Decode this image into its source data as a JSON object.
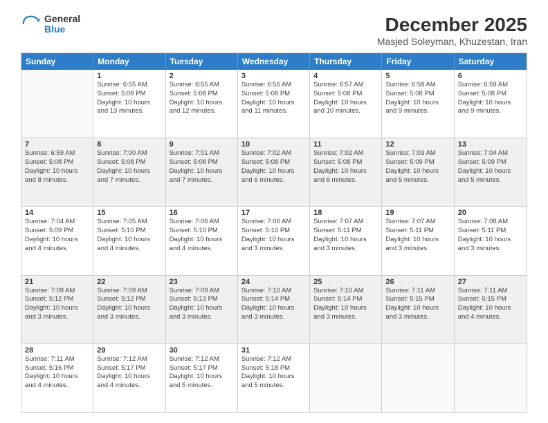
{
  "logo": {
    "general": "General",
    "blue": "Blue"
  },
  "title": "December 2025",
  "subtitle": "Masjed Soleyman, Khuzestan, Iran",
  "headers": [
    "Sunday",
    "Monday",
    "Tuesday",
    "Wednesday",
    "Thursday",
    "Friday",
    "Saturday"
  ],
  "rows": [
    [
      {
        "day": "",
        "empty": true
      },
      {
        "day": "1",
        "lines": [
          "Sunrise: 6:55 AM",
          "Sunset: 5:08 PM",
          "Daylight: 10 hours",
          "and 13 minutes."
        ]
      },
      {
        "day": "2",
        "lines": [
          "Sunrise: 6:55 AM",
          "Sunset: 5:08 PM",
          "Daylight: 10 hours",
          "and 12 minutes."
        ]
      },
      {
        "day": "3",
        "lines": [
          "Sunrise: 6:56 AM",
          "Sunset: 5:08 PM",
          "Daylight: 10 hours",
          "and 11 minutes."
        ]
      },
      {
        "day": "4",
        "lines": [
          "Sunrise: 6:57 AM",
          "Sunset: 5:08 PM",
          "Daylight: 10 hours",
          "and 10 minutes."
        ]
      },
      {
        "day": "5",
        "lines": [
          "Sunrise: 6:58 AM",
          "Sunset: 5:08 PM",
          "Daylight: 10 hours",
          "and 9 minutes."
        ]
      },
      {
        "day": "6",
        "lines": [
          "Sunrise: 6:59 AM",
          "Sunset: 5:08 PM",
          "Daylight: 10 hours",
          "and 9 minutes."
        ]
      }
    ],
    [
      {
        "day": "7",
        "lines": [
          "Sunrise: 6:59 AM",
          "Sunset: 5:08 PM",
          "Daylight: 10 hours",
          "and 8 minutes."
        ],
        "shaded": true
      },
      {
        "day": "8",
        "lines": [
          "Sunrise: 7:00 AM",
          "Sunset: 5:08 PM",
          "Daylight: 10 hours",
          "and 7 minutes."
        ],
        "shaded": true
      },
      {
        "day": "9",
        "lines": [
          "Sunrise: 7:01 AM",
          "Sunset: 5:08 PM",
          "Daylight: 10 hours",
          "and 7 minutes."
        ],
        "shaded": true
      },
      {
        "day": "10",
        "lines": [
          "Sunrise: 7:02 AM",
          "Sunset: 5:08 PM",
          "Daylight: 10 hours",
          "and 6 minutes."
        ],
        "shaded": true
      },
      {
        "day": "11",
        "lines": [
          "Sunrise: 7:02 AM",
          "Sunset: 5:08 PM",
          "Daylight: 10 hours",
          "and 6 minutes."
        ],
        "shaded": true
      },
      {
        "day": "12",
        "lines": [
          "Sunrise: 7:03 AM",
          "Sunset: 5:09 PM",
          "Daylight: 10 hours",
          "and 5 minutes."
        ],
        "shaded": true
      },
      {
        "day": "13",
        "lines": [
          "Sunrise: 7:04 AM",
          "Sunset: 5:09 PM",
          "Daylight: 10 hours",
          "and 5 minutes."
        ],
        "shaded": true
      }
    ],
    [
      {
        "day": "14",
        "lines": [
          "Sunrise: 7:04 AM",
          "Sunset: 5:09 PM",
          "Daylight: 10 hours",
          "and 4 minutes."
        ]
      },
      {
        "day": "15",
        "lines": [
          "Sunrise: 7:05 AM",
          "Sunset: 5:10 PM",
          "Daylight: 10 hours",
          "and 4 minutes."
        ]
      },
      {
        "day": "16",
        "lines": [
          "Sunrise: 7:06 AM",
          "Sunset: 5:10 PM",
          "Daylight: 10 hours",
          "and 4 minutes."
        ]
      },
      {
        "day": "17",
        "lines": [
          "Sunrise: 7:06 AM",
          "Sunset: 5:10 PM",
          "Daylight: 10 hours",
          "and 3 minutes."
        ]
      },
      {
        "day": "18",
        "lines": [
          "Sunrise: 7:07 AM",
          "Sunset: 5:11 PM",
          "Daylight: 10 hours",
          "and 3 minutes."
        ]
      },
      {
        "day": "19",
        "lines": [
          "Sunrise: 7:07 AM",
          "Sunset: 5:11 PM",
          "Daylight: 10 hours",
          "and 3 minutes."
        ]
      },
      {
        "day": "20",
        "lines": [
          "Sunrise: 7:08 AM",
          "Sunset: 5:11 PM",
          "Daylight: 10 hours",
          "and 3 minutes."
        ]
      }
    ],
    [
      {
        "day": "21",
        "lines": [
          "Sunrise: 7:09 AM",
          "Sunset: 5:12 PM",
          "Daylight: 10 hours",
          "and 3 minutes."
        ],
        "shaded": true
      },
      {
        "day": "22",
        "lines": [
          "Sunrise: 7:09 AM",
          "Sunset: 5:12 PM",
          "Daylight: 10 hours",
          "and 3 minutes."
        ],
        "shaded": true
      },
      {
        "day": "23",
        "lines": [
          "Sunrise: 7:09 AM",
          "Sunset: 5:13 PM",
          "Daylight: 10 hours",
          "and 3 minutes."
        ],
        "shaded": true
      },
      {
        "day": "24",
        "lines": [
          "Sunrise: 7:10 AM",
          "Sunset: 5:14 PM",
          "Daylight: 10 hours",
          "and 3 minutes."
        ],
        "shaded": true
      },
      {
        "day": "25",
        "lines": [
          "Sunrise: 7:10 AM",
          "Sunset: 5:14 PM",
          "Daylight: 10 hours",
          "and 3 minutes."
        ],
        "shaded": true
      },
      {
        "day": "26",
        "lines": [
          "Sunrise: 7:11 AM",
          "Sunset: 5:15 PM",
          "Daylight: 10 hours",
          "and 3 minutes."
        ],
        "shaded": true
      },
      {
        "day": "27",
        "lines": [
          "Sunrise: 7:11 AM",
          "Sunset: 5:15 PM",
          "Daylight: 10 hours",
          "and 4 minutes."
        ],
        "shaded": true
      }
    ],
    [
      {
        "day": "28",
        "lines": [
          "Sunrise: 7:11 AM",
          "Sunset: 5:16 PM",
          "Daylight: 10 hours",
          "and 4 minutes."
        ]
      },
      {
        "day": "29",
        "lines": [
          "Sunrise: 7:12 AM",
          "Sunset: 5:17 PM",
          "Daylight: 10 hours",
          "and 4 minutes."
        ]
      },
      {
        "day": "30",
        "lines": [
          "Sunrise: 7:12 AM",
          "Sunset: 5:17 PM",
          "Daylight: 10 hours",
          "and 5 minutes."
        ]
      },
      {
        "day": "31",
        "lines": [
          "Sunrise: 7:12 AM",
          "Sunset: 5:18 PM",
          "Daylight: 10 hours",
          "and 5 minutes."
        ]
      },
      {
        "day": "",
        "empty": true
      },
      {
        "day": "",
        "empty": true
      },
      {
        "day": "",
        "empty": true
      }
    ]
  ]
}
